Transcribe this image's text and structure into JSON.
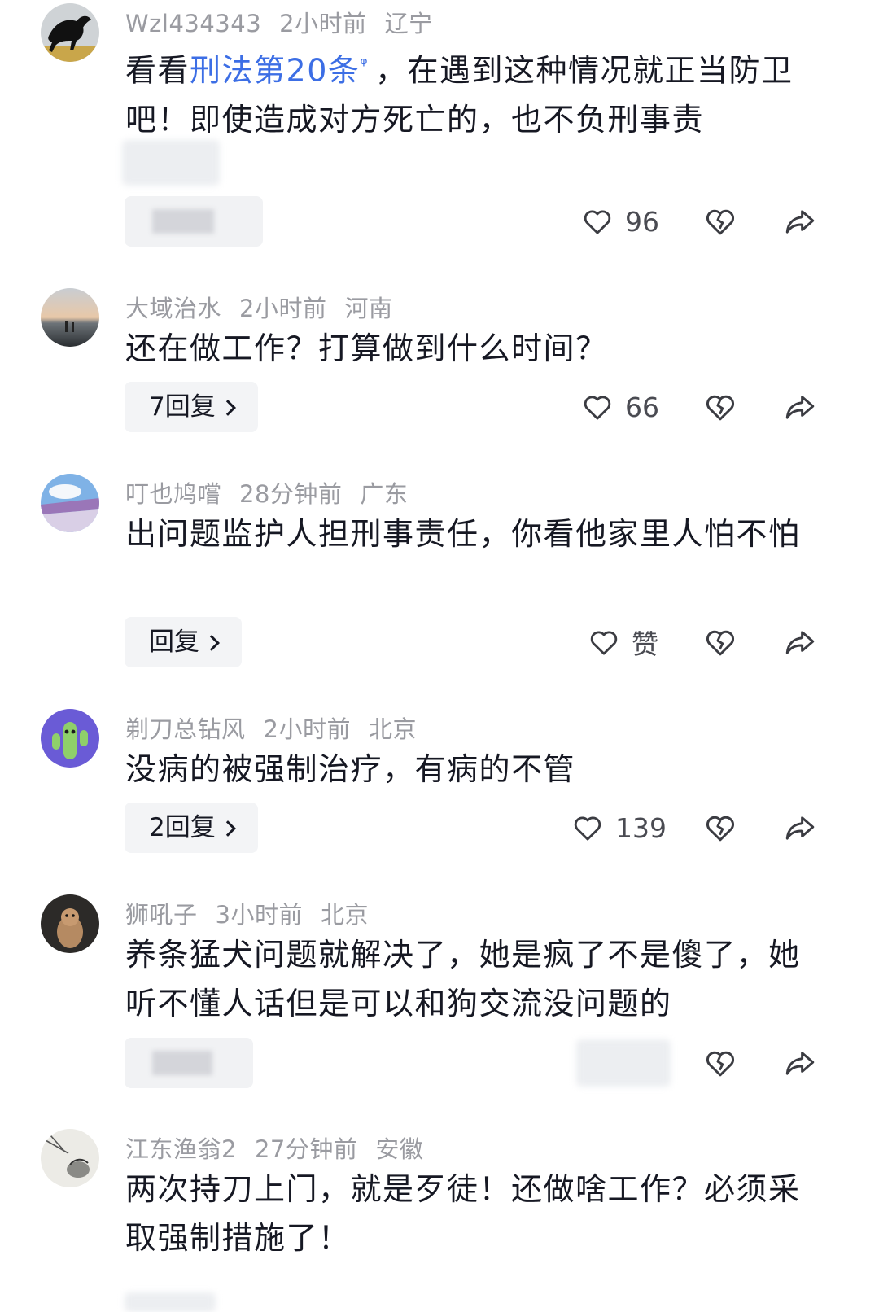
{
  "comments": [
    {
      "user": "Wzl434343",
      "time": "2小时前",
      "region": "辽宁",
      "text_before": "看看",
      "link_text": "刑法第20条",
      "search_glyph": "ᵠ",
      "text_after": "，在遇到这种情况就正当防卫吧！即使造成对方死亡的，也不负刑事责",
      "reply_label": "",
      "likes": "96"
    },
    {
      "user": "大域治水",
      "time": "2小时前",
      "region": "河南",
      "text": "还在做工作？打算做到什么时间？",
      "reply_label": "7回复",
      "likes": "66"
    },
    {
      "user": "叮也鸠嚐",
      "time": "28分钟前",
      "region": "广东",
      "text": "出问题监护人担刑事责任，你看他家里人怕不怕",
      "reply_label": "回复",
      "likes": "赞"
    },
    {
      "user": "剃刀总钻风",
      "time": "2小时前",
      "region": "北京",
      "text": "没病的被强制治疗，有病的不管",
      "reply_label": "2回复",
      "likes": "139"
    },
    {
      "user": "狮吼子",
      "time": "3小时前",
      "region": "北京",
      "text": "养条猛犬问题就解决了，她是疯了不是傻了，她听不懂人话但是可以和狗交流没问题的",
      "reply_label": "",
      "likes": ""
    },
    {
      "user": "江东渔翁2",
      "time": "27分钟前",
      "region": "安徽",
      "text": "两次持刀上门，就是歹徒！还做啥工作？必须采取强制措施了！",
      "reply_label": "",
      "likes": ""
    }
  ],
  "colors": {
    "link": "#3c6ee5",
    "meta": "#9a9ba1",
    "text": "#161823",
    "button_bg": "#f3f4f6"
  },
  "icons": {
    "like": "heart-outline-icon",
    "dislike": "broken-heart-icon",
    "share": "share-arrow-icon",
    "reply_chevron": "chevron-right-icon"
  }
}
